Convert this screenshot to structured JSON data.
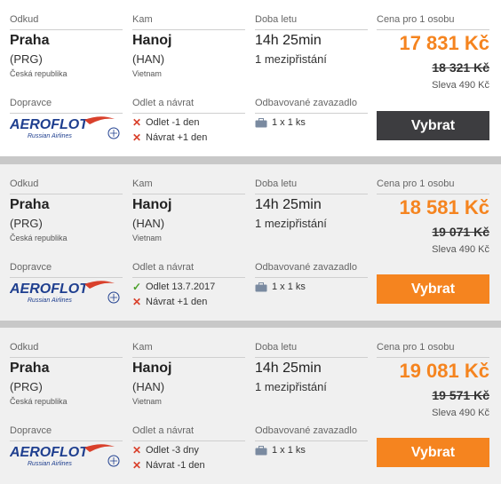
{
  "labels": {
    "from": "Odkud",
    "to": "Kam",
    "duration": "Doba letu",
    "price": "Cena pro 1 osobu",
    "carrier": "Dopravce",
    "dates": "Odlet a návrat",
    "baggage": "Odbavované zavazadlo"
  },
  "button_label": "Vybrat",
  "airline": {
    "name": "AEROFLOT",
    "subtitle": "Russian Airlines"
  },
  "colors": {
    "accent": "#f5841f",
    "dark_button": "#3d3d40",
    "cross": "#d9402b",
    "check": "#4ba02a"
  },
  "flights": [
    {
      "from_city": "Praha",
      "from_code": "(PRG)",
      "from_country": "Česká republika",
      "to_city": "Hanoj",
      "to_code": "(HAN)",
      "to_country": "Vietnam",
      "duration": "14h 25min",
      "stops": "1 mezipřistání",
      "price": "17 831 Kč",
      "old_price": "18 321 Kč",
      "discount": "Sleva 490 Kč",
      "departure": {
        "icon": "cross-icon",
        "text": "Odlet -1 den"
      },
      "return": {
        "icon": "cross-icon",
        "text": "Návrat +1 den"
      },
      "baggage": "1 x 1 ks",
      "button_style": "dark"
    },
    {
      "from_city": "Praha",
      "from_code": "(PRG)",
      "from_country": "Česká republika",
      "to_city": "Hanoj",
      "to_code": "(HAN)",
      "to_country": "Vietnam",
      "duration": "14h 25min",
      "stops": "1 mezipřistání",
      "price": "18 581 Kč",
      "old_price": "19 071 Kč",
      "discount": "Sleva 490 Kč",
      "departure": {
        "icon": "check-icon",
        "text": "Odlet 13.7.2017"
      },
      "return": {
        "icon": "cross-icon",
        "text": "Návrat +1 den"
      },
      "baggage": "1 x 1 ks",
      "button_style": "orange"
    },
    {
      "from_city": "Praha",
      "from_code": "(PRG)",
      "from_country": "Česká republika",
      "to_city": "Hanoj",
      "to_code": "(HAN)",
      "to_country": "Vietnam",
      "duration": "14h 25min",
      "stops": "1 mezipřistání",
      "price": "19 081 Kč",
      "old_price": "19 571 Kč",
      "discount": "Sleva 490 Kč",
      "departure": {
        "icon": "cross-icon",
        "text": "Odlet -3 dny"
      },
      "return": {
        "icon": "cross-icon",
        "text": "Návrat -1 den"
      },
      "baggage": "1 x 1 ks",
      "button_style": "orange"
    }
  ]
}
